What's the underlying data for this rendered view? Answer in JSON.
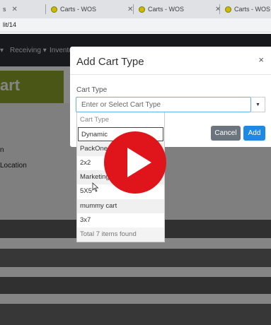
{
  "browser": {
    "tabs": [
      {
        "label": "s",
        "close": "✕"
      },
      {
        "label": "Carts - WOS",
        "close": "✕"
      },
      {
        "label": "Carts - WOS",
        "close": "✕"
      },
      {
        "label": "Carts - WOS",
        "close": ""
      }
    ],
    "url": "lit/14"
  },
  "app": {
    "nav": {
      "receiving": "Receiving ▾",
      "inventory": "Invento",
      "left_caret": "▾"
    },
    "banner": "art",
    "row_labels": [
      "n",
      "Location"
    ]
  },
  "modal": {
    "title": "Add Cart Type",
    "close": "×",
    "field_label": "Cart Type",
    "select_placeholder": "Enter or Select Cart Type",
    "caret": "▼",
    "cancel_label": "Cancel",
    "add_label": "Add"
  },
  "dropdown": {
    "header": "Cart Type",
    "search_value": "Dynamic",
    "options": [
      "PackOne",
      "2x2",
      "Marketing",
      "5X5",
      "mummy cart",
      "3x7"
    ],
    "footer": "Total 7 items found"
  },
  "colors": {
    "accent_primary": "#1e88e5",
    "cancel_gray": "#6c757d",
    "banner_green": "#8fa62a",
    "play_red": "#e0141b"
  },
  "icons": [
    "play-icon",
    "cursor-icon",
    "close-icon",
    "caret-down-icon"
  ]
}
